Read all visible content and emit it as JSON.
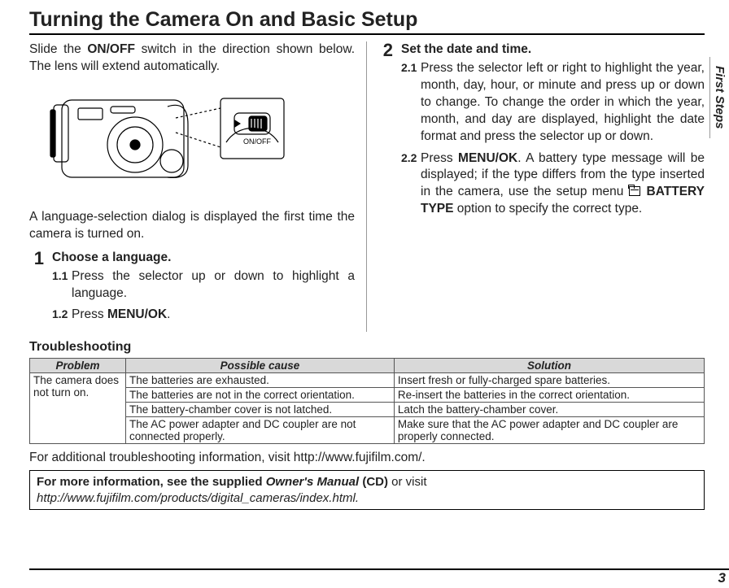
{
  "title": "Turning the Camera On and Basic Setup",
  "side_tab": "First Steps",
  "page_number": "3",
  "intro1": "Slide the ",
  "intro1_bold": "ON/OFF",
  "intro1_cont": " switch in the direction shown below.  The lens will extend automatically.",
  "camera_slider_label": "ON/OFF",
  "after_illus": "A language-selection dialog is displayed the first time the camera is turned on.",
  "step1": {
    "num": "1",
    "head": "Choose a language.",
    "s1_num": "1.1",
    "s1_text": "Press the selector up or down to highlight a language.",
    "s2_num": "1.2",
    "s2_text_pre": "Press ",
    "s2_text_bold": "MENU/OK",
    "s2_text_post": "."
  },
  "step2": {
    "num": "2",
    "head": "Set the date and time.",
    "s1_num": "2.1",
    "s1_text": "Press the selector left or right to highlight the year, month, day, hour, or minute and press up or down to change.  To change the order in which the year, month, and day are displayed, highlight the date format and press the selector up or down.",
    "s2_num": "2.2",
    "s2_a": "Press ",
    "s2_b": "MENU/OK",
    "s2_c": ".  A battery type message will be displayed; if the type differs from the type inserted in the camera, use the setup menu ",
    "s2_d": " BATTERY TYPE",
    "s2_e": " option to specify the correct type."
  },
  "trouble_head": "Troubleshooting",
  "table": {
    "h1": "Problem",
    "h2": "Possible cause",
    "h3": "Solution",
    "problem": "The camera does not turn on.",
    "rows": [
      {
        "cause": "The batteries are exhausted.",
        "sol": "Insert fresh or fully-charged spare batteries."
      },
      {
        "cause": "The batteries are not in the correct orientation.",
        "sol": "Re-insert the batteries in the correct orientation."
      },
      {
        "cause": "The battery-chamber cover is not latched.",
        "sol": "Latch the battery-chamber cover."
      },
      {
        "cause": "The AC power adapter and DC coupler are not connected properly.",
        "sol": "Make sure that the AC power adapter and DC coupler are properly connected."
      }
    ]
  },
  "addl": "For additional troubleshooting information, visit http://www.fujifilm.com/.",
  "box": {
    "a": "For more information, see the supplied ",
    "b": "Owner's Manual",
    "c": " (CD)",
    "d": " or visit",
    "e": "http://www.fujifilm.com/products/digital_cameras/index.html."
  }
}
